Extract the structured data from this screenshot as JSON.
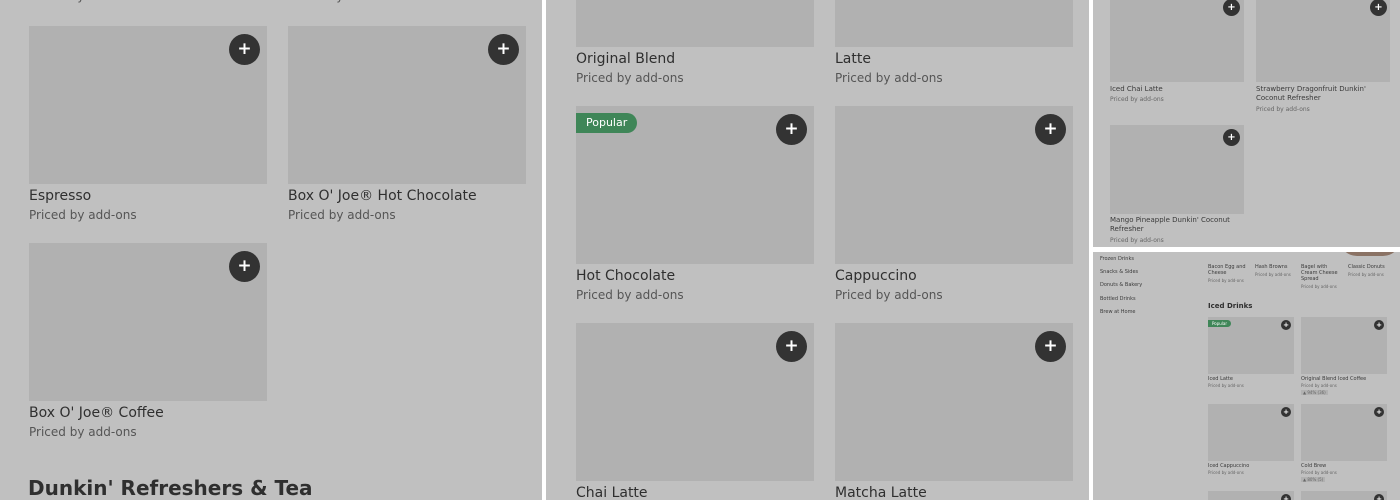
{
  "price_text": "Priced by add-ons",
  "colors": {
    "overlay": "#c0c0c0",
    "tile": "#b1b1b1",
    "add_button": "#333333",
    "badge": "#3f8658"
  },
  "panel1": {
    "items": [
      "Espresso",
      "Box O' Joe® Hot Chocolate",
      "Box O' Joe® Coffee"
    ],
    "section_title": "Dunkin' Refreshers & Tea"
  },
  "panel2": {
    "items": [
      "Original Blend",
      "Latte",
      "Hot Chocolate",
      "Cappuccino",
      "Chai Latte",
      "Matcha Latte"
    ],
    "badge": "Popular"
  },
  "panel3": {
    "items": [
      "Iced Chai Latte",
      "Strawberry Dragonfruit Dunkin' Coconut Refresher",
      "Mango Pineapple Dunkin' Coconut Refresher"
    ]
  },
  "panel4": {
    "sidebar": [
      "Frozen Drinks",
      "Snacks & Sides",
      "Donuts & Bakery",
      "Bottled Drinks",
      "Brew at Home"
    ],
    "top_items": [
      "Bacon Egg and Cheese",
      "Hash Browns",
      "Bagel with Cream Cheese Spread",
      "Classic Donuts"
    ],
    "section_title": "Iced Drinks",
    "badge": "Popular",
    "items": [
      "Iced Latte",
      "Original Blend Iced Coffee",
      "Iced Cappuccino",
      "Cold Brew"
    ],
    "ratings": [
      "94% (36)",
      "80% (5)"
    ]
  }
}
